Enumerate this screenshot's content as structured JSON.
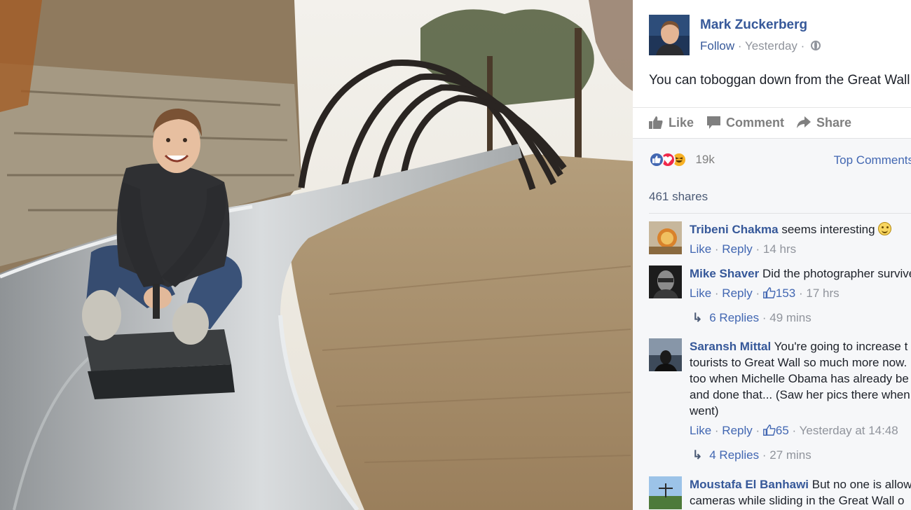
{
  "post": {
    "author": "Mark Zuckerberg",
    "follow": "Follow",
    "time": "Yesterday",
    "dot": " · ",
    "text": "You can toboggan down from the Great Wall"
  },
  "actions": {
    "like": "Like",
    "comment": "Comment",
    "share": "Share"
  },
  "feedback": {
    "reaction_count": "19k",
    "top_comments": "Top Comments",
    "shares": "461 shares"
  },
  "comments": [
    {
      "name": "Tribeni Chakma",
      "text": "seems interesting",
      "like": "Like",
      "reply": "Reply",
      "likes": "",
      "time": "14 hrs"
    },
    {
      "name": "Mike Shaver",
      "text": "Did the photographer survive?",
      "like": "Like",
      "reply": "Reply",
      "likes": "153",
      "time": "17 hrs",
      "replies": "6 Replies",
      "replies_time": "49 mins"
    },
    {
      "name": "Saransh Mittal",
      "text": "You're going to increase the tourists to Great Wall so much more now. I feel too when Michelle Obama has already been there and done that... (Saw her pics there when she went)",
      "line1": "You're going to increase t",
      "line2": "tourists to Great Wall so much more now. I",
      "line3": "too when Michelle Obama has already be",
      "line4": "and done that... (Saw her pics there when",
      "line5": "went)",
      "like": "Like",
      "reply": "Reply",
      "likes": "65",
      "time": "Yesterday at 14:48",
      "replies": "4 Replies",
      "replies_time": "27 mins"
    },
    {
      "name": "Moustafa El Banhawi",
      "line1": "But no one is allow",
      "line2": "cameras while sliding in the Great Wall o"
    }
  ],
  "icons": {
    "like": "thumbs-up-icon",
    "comment": "speech-bubble-icon",
    "share": "share-arrow-icon",
    "globe": "globe-icon",
    "reply_arrow": "reply-arrow-icon"
  },
  "colors": {
    "fb_blue": "#365899",
    "link_blue": "#4267b2",
    "muted": "#90949c"
  }
}
